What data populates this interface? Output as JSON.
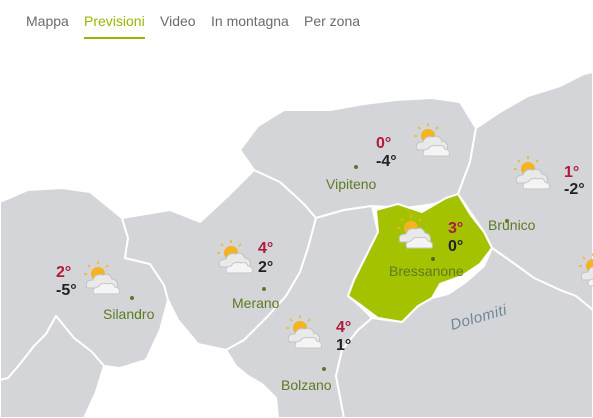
{
  "tabs": [
    {
      "label": "Mappa",
      "active": false
    },
    {
      "label": "Previsioni",
      "active": true
    },
    {
      "label": "Video",
      "active": false
    },
    {
      "label": "In montagna",
      "active": false
    },
    {
      "label": "Per zona",
      "active": false
    }
  ],
  "colors": {
    "accent": "#94b800",
    "region": "#d4d5d8",
    "border": "#ffffff",
    "highlight": "#a5c200",
    "max_temp": "#b01a3c",
    "min_temp": "#222222",
    "city_label": "#5d7a24"
  },
  "map": {
    "region_label": "Dolomiti",
    "weather_icon": "partly-cloudy-icon",
    "stations": [
      {
        "name": "Vipiteno",
        "max": "0°",
        "min": "-4°"
      },
      {
        "name": "Brunico",
        "max": "1°",
        "min": "-2°"
      },
      {
        "name": "Bressanone",
        "max": "3°",
        "min": "0°",
        "highlighted": true
      },
      {
        "name": "Silandro",
        "max": "2°",
        "min": "-5°"
      },
      {
        "name": "Merano",
        "max": "4°",
        "min": "2°"
      },
      {
        "name": "Bolzano",
        "max": "4°",
        "min": "1°"
      }
    ]
  }
}
